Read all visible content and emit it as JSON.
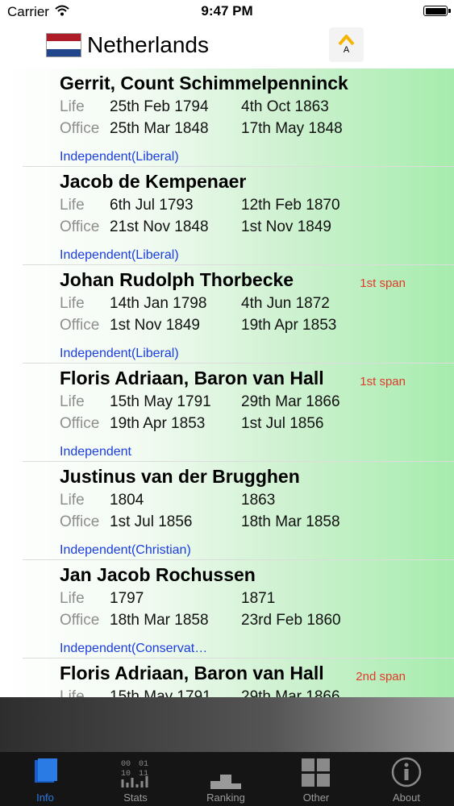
{
  "status_bar": {
    "carrier": "Carrier",
    "time": "9:47 PM"
  },
  "header": {
    "title": "Netherlands",
    "app_icon_letter": "A"
  },
  "labels": {
    "life": "Life",
    "office": "Office"
  },
  "prime_ministers": [
    {
      "name": "Gerrit, Count Schimmelpenninck",
      "span": "",
      "life_start": "25th Feb 1794",
      "life_end": "4th Oct 1863",
      "office_start": "25th Mar 1848",
      "office_end": "17th May 1848",
      "party": "Independent(Liberal)"
    },
    {
      "name": "Jacob de Kempenaer",
      "span": "",
      "life_start": "6th Jul 1793",
      "life_end": "12th Feb 1870",
      "office_start": "21st Nov 1848",
      "office_end": "1st Nov 1849",
      "party": "Independent(Liberal)"
    },
    {
      "name": "Johan Rudolph Thorbecke",
      "span": "1st span",
      "life_start": "14th Jan 1798",
      "life_end": "4th Jun 1872",
      "office_start": "1st Nov 1849",
      "office_end": "19th Apr 1853",
      "party": "Independent(Liberal)"
    },
    {
      "name": "Floris Adriaan, Baron van Hall",
      "span": "1st span",
      "life_start": "15th May 1791",
      "life_end": "29th Mar 1866",
      "office_start": "19th Apr 1853",
      "office_end": "1st Jul 1856",
      "party": "Independent"
    },
    {
      "name": "Justinus van der Brugghen",
      "span": "",
      "life_start": "1804",
      "life_end": "1863",
      "office_start": "1st Jul 1856",
      "office_end": "18th Mar 1858",
      "party": "Independent(Christian)"
    },
    {
      "name": "Jan Jacob Rochussen",
      "span": "",
      "life_start": "1797",
      "life_end": "1871",
      "office_start": "18th Mar 1858",
      "office_end": "23rd Feb 1860",
      "party": "Independent(Conservat…"
    },
    {
      "name": "Floris Adriaan, Baron van Hall",
      "span": "2nd span",
      "life_start": "15th May 1791",
      "life_end": "29th Mar 1866",
      "office_start": "",
      "office_end": "",
      "party": ""
    }
  ],
  "tabs": [
    {
      "label": "Info",
      "icon": "book-icon",
      "active": true
    },
    {
      "label": "Stats",
      "icon": "binary-chart-icon",
      "active": false
    },
    {
      "label": "Ranking",
      "icon": "podium-icon",
      "active": false
    },
    {
      "label": "Other",
      "icon": "grid-icon",
      "active": false
    },
    {
      "label": "About",
      "icon": "info-circle-icon",
      "active": false
    }
  ],
  "colors": {
    "party_text": "#1a3de0",
    "span_text": "#e23a2a",
    "active_tab": "#2a7be4",
    "list_gradient_end": "#a6ecad"
  }
}
